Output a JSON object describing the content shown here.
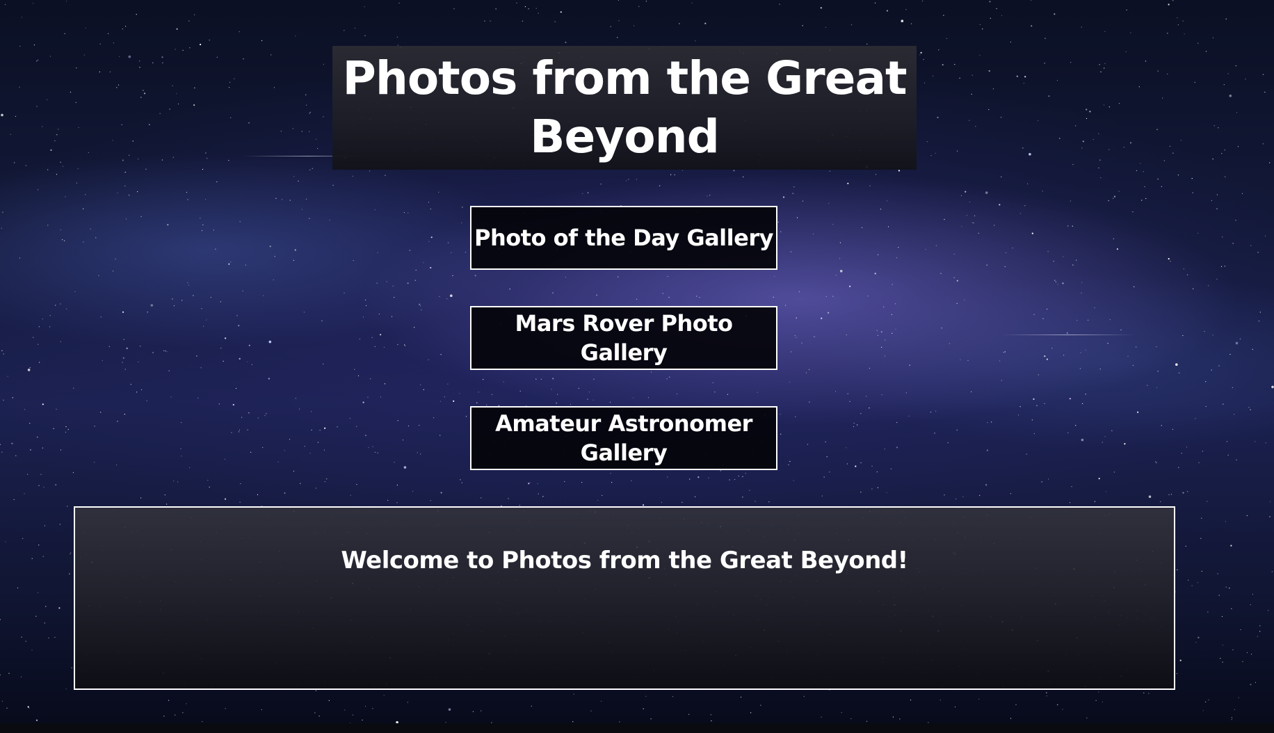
{
  "header": {
    "title": "Photos from the Great Beyond"
  },
  "nav": {
    "buttons": [
      {
        "label": "Photo of the Day Gallery"
      },
      {
        "label": "Mars Rover Photo Gallery"
      },
      {
        "label": "Amateur Astronomer Gallery"
      }
    ]
  },
  "main": {
    "welcome_text": "Welcome to Photos from the Great Beyond!"
  },
  "theme": {
    "text_color": "#ffffff",
    "button_border_color": "#ffffff",
    "button_background": "#04040a",
    "title_box_background": "#2a2a32",
    "background_image": "starry-night-milky-way"
  }
}
